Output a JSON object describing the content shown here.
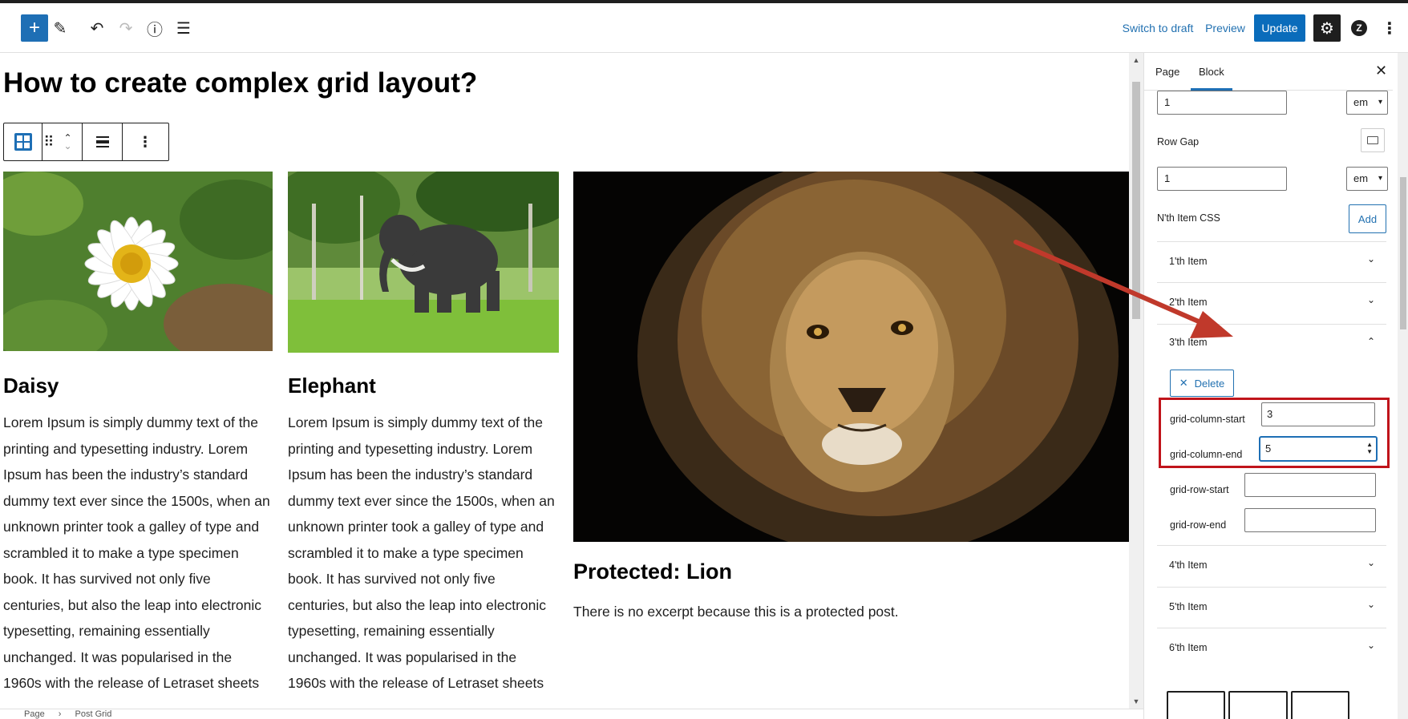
{
  "toolbar": {
    "switch_to_draft": "Switch to draft",
    "preview": "Preview",
    "update": "Update",
    "add_icon_glyph": "+",
    "edit_icon_glyph": "✎",
    "undo_icon_glyph": "↶",
    "redo_icon_glyph": "↷",
    "info_icon_glyph": "ⓘ",
    "list_icon_glyph": "☰",
    "settings_icon_glyph": "⚙",
    "jetpack_icon_glyph": "Z",
    "more_icon_glyph": "⋮"
  },
  "post": {
    "title": "How to create complex grid layout?"
  },
  "cards": [
    {
      "title": "Daisy",
      "image": "daisy-photo",
      "lines": [
        "Lorem Ipsum is simply dummy text of the",
        "printing and typesetting industry. Lorem",
        "Ipsum has been the industry’s standard",
        "dummy text ever since the 1500s, when an",
        "unknown printer took a galley of type and",
        "scrambled it to make a type specimen",
        "book. It has survived not only five",
        "centuries, but also the leap into electronic",
        "typesetting, remaining essentially",
        "unchanged. It was popularised in the",
        "1960s with the release of Letraset sheets"
      ]
    },
    {
      "title": "Elephant",
      "image": "elephant-photo",
      "lines": [
        "Lorem Ipsum is simply dummy text of the",
        "printing and typesetting industry. Lorem",
        "Ipsum has been the industry’s standard",
        "dummy text ever since the 1500s, when an",
        "unknown printer took a galley of type and",
        "scrambled it to make a type specimen",
        "book. It has survived not only five",
        "centuries, but also the leap into electronic",
        "typesetting, remaining essentially",
        "unchanged. It was popularised in the",
        "1960s with the release of Letraset sheets"
      ]
    },
    {
      "title": "Protected: Lion",
      "image": "lion-photo",
      "excerpt": "There is no excerpt because this is a protected post."
    }
  ],
  "footer": {
    "breadcrumb": [
      "Page",
      "Post Grid"
    ],
    "separator": "›"
  },
  "sidebar": {
    "tabs": [
      "Page",
      "Block"
    ],
    "active_tab": "Block",
    "close_glyph": "✕",
    "column_gap_value": "1",
    "column_gap_unit": "em",
    "row_gap_label": "Row Gap",
    "row_gap_value": "1",
    "row_gap_unit": "em",
    "nth_item_label": "N'th Item CSS",
    "add_label": "Add",
    "items": [
      {
        "label": "1'th Item",
        "expanded": false
      },
      {
        "label": "2'th Item",
        "expanded": false
      },
      {
        "label": "3'th Item",
        "expanded": true
      },
      {
        "label": "4'th Item",
        "expanded": false
      },
      {
        "label": "5'th Item",
        "expanded": false
      },
      {
        "label": "6'th Item",
        "expanded": false
      }
    ],
    "chevron_down": "⌄",
    "chevron_up": "⌃",
    "delete_label": "Delete",
    "fields": {
      "grid_column_start_label": "grid-column-start",
      "grid_column_start_value": "3",
      "grid_column_end_label": "grid-column-end",
      "grid_column_end_value": "5",
      "grid_row_start_label": "grid-row-start",
      "grid_row_start_value": "",
      "grid_row_end_label": "grid-row-end",
      "grid_row_end_value": ""
    }
  },
  "colors": {
    "accent": "#1e6fb5",
    "annotation_red": "#c0141b",
    "arrow_red": "#c0392b"
  }
}
